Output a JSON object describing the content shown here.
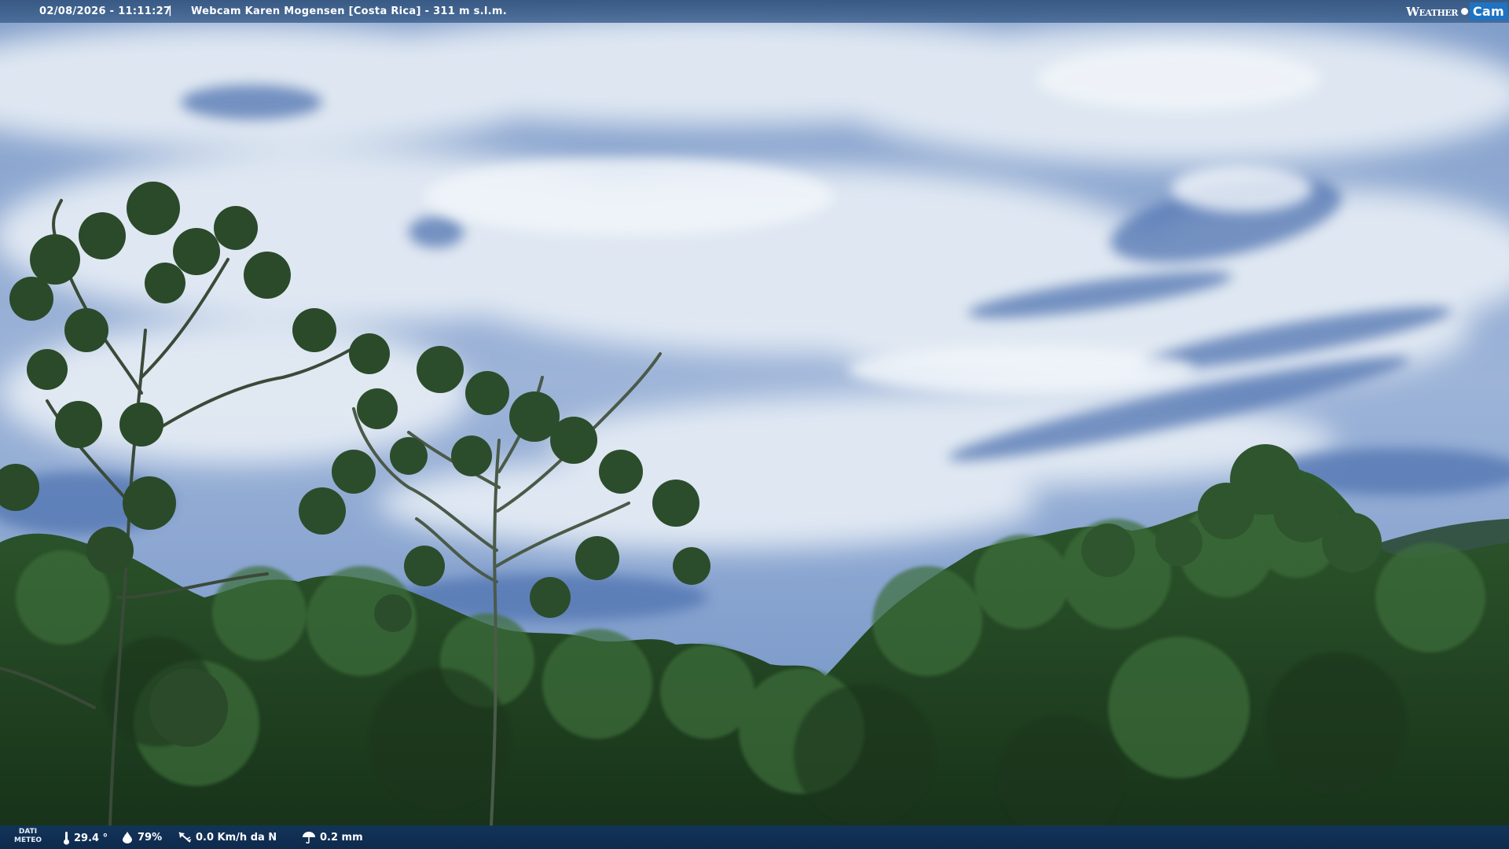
{
  "top_bar": {
    "datetime": "02/08/2026 - 11:11:27",
    "separator": "|",
    "title": "Webcam Karen Mogensen [Costa Rica]  - 311 m s.l.m.",
    "logo": {
      "part1": "Weather",
      "part2": "Cam"
    }
  },
  "bottom_bar": {
    "label_line1": "DATI",
    "label_line2": "METEO",
    "temperature": "29.4 °",
    "humidity": "79%",
    "wind": "0.0 Km/h da N",
    "rain": "0.2 mm",
    "icons": [
      "thermometer-icon",
      "humidity-drop-icon",
      "wind-direction-icon",
      "rain-icon"
    ]
  },
  "colors": {
    "sky_top": "#5f80b8",
    "sky_mid": "#8fa9d0",
    "cloud": "#e4ebf3",
    "foliage_dark": "#1c3a1d",
    "foliage_mid": "#2d5a2c",
    "bar_top": "#355a86",
    "bar_bottom": "#12345f",
    "logo_blue": "#1f73c2"
  }
}
